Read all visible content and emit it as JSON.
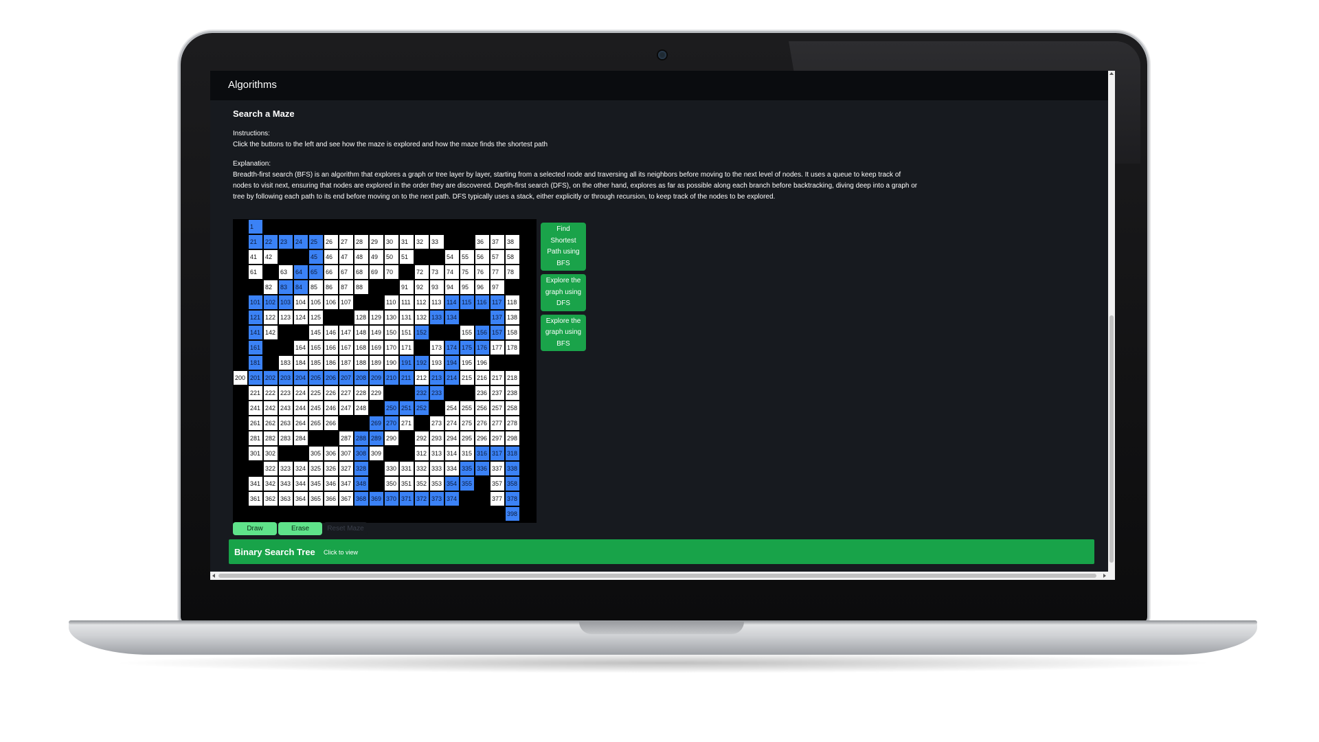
{
  "app": {
    "brand": "Algorithms"
  },
  "section": {
    "title": "Search a Maze",
    "instructions_label": "Instructions:",
    "instructions_text": "Click the buttons to the left and see how the maze is explored and how the maze finds the shortest path",
    "explanation_label": "Explanation:",
    "explanation_text": "Breadth-first search (BFS) is an algorithm that explores a graph or tree layer by layer, starting from a selected node and traversing all its neighbors before moving to the next level of nodes. It uses a queue to keep track of nodes to visit next, ensuring that nodes are explored in the order they are discovered. Depth-first search (DFS), on the other hand, explores as far as possible along each branch before backtracking, diving deep into a graph or tree by following each path to its end before moving on to the next path. DFS typically uses a stack, either explicitly or through recursion, to keep track of the nodes to be explored."
  },
  "maze": {
    "columns": 20,
    "rows": 20,
    "walls": [
      0,
      2,
      3,
      4,
      5,
      6,
      7,
      8,
      9,
      10,
      11,
      12,
      13,
      14,
      15,
      16,
      17,
      18,
      19,
      20,
      34,
      35,
      39,
      40,
      43,
      44,
      52,
      53,
      59,
      60,
      62,
      71,
      79,
      80,
      81,
      89,
      90,
      98,
      99,
      100,
      108,
      109,
      119,
      120,
      126,
      127,
      135,
      136,
      139,
      140,
      143,
      144,
      153,
      154,
      159,
      160,
      162,
      163,
      172,
      179,
      180,
      182,
      197,
      198,
      199,
      219,
      220,
      230,
      231,
      234,
      235,
      239,
      240,
      249,
      253,
      259,
      260,
      267,
      268,
      272,
      279,
      280,
      285,
      286,
      291,
      299,
      300,
      303,
      304,
      310,
      311,
      319,
      320,
      321,
      329,
      339,
      340,
      349,
      356,
      359,
      360,
      375,
      376,
      379,
      380,
      381,
      382,
      383,
      384,
      385,
      386,
      387,
      388,
      389,
      390,
      391,
      392,
      393,
      394,
      395,
      396,
      397,
      399
    ],
    "highlighted": [
      1,
      21,
      22,
      23,
      24,
      25,
      45,
      64,
      65,
      83,
      84,
      101,
      102,
      103,
      114,
      115,
      116,
      117,
      121,
      133,
      134,
      137,
      141,
      152,
      153,
      156,
      157,
      161,
      172,
      174,
      175,
      176,
      181,
      191,
      192,
      194,
      201,
      202,
      203,
      204,
      205,
      206,
      207,
      208,
      209,
      210,
      211,
      213,
      214,
      232,
      233,
      250,
      251,
      252,
      269,
      270,
      288,
      289,
      308,
      316,
      317,
      318,
      328,
      335,
      336,
      338,
      348,
      354,
      355,
      358,
      368,
      369,
      370,
      371,
      372,
      373,
      374,
      378,
      398
    ]
  },
  "side_buttons": [
    {
      "label": "Find Shortest Path using BFS"
    },
    {
      "label": "Explore the graph using DFS"
    },
    {
      "label": "Explore the graph using BFS"
    }
  ],
  "maze_buttons": {
    "draw": "Draw",
    "erase": "Erase",
    "reset": "Reset Maze"
  },
  "bst": {
    "title": "Binary Search Tree",
    "link": "Click to view"
  },
  "colors": {
    "accent_green": "#18a349",
    "light_green": "#5fe38a",
    "highlight_blue": "#3b82f6",
    "background": "#171a1f",
    "navbar": "#0a0c0f"
  }
}
